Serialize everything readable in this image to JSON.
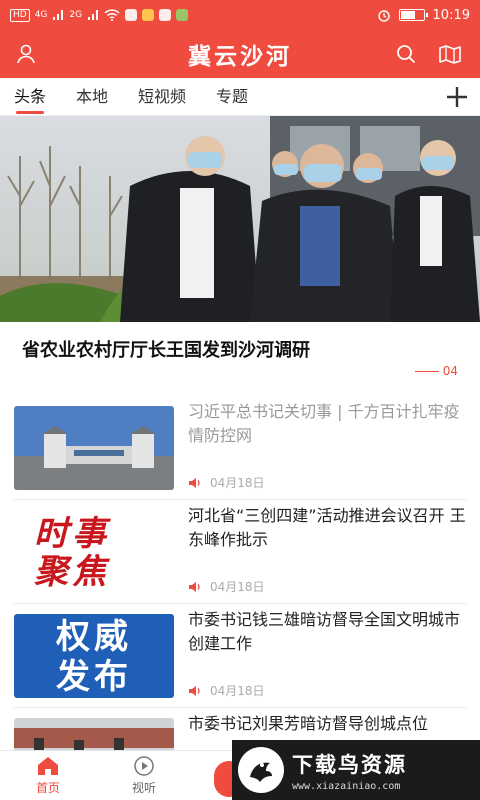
{
  "status_bar": {
    "left_chip": "HD",
    "signal_1": "4G",
    "signal_2": "2G",
    "time": "10:19"
  },
  "header": {
    "title": "冀云沙河"
  },
  "tabs": [
    {
      "label": "头条",
      "active": true
    },
    {
      "label": "本地",
      "active": false
    },
    {
      "label": "短视频",
      "active": false
    },
    {
      "label": "专题",
      "active": false
    }
  ],
  "hero": {
    "title": "省农业农村厅厅长王国发到沙河调研",
    "index": "04"
  },
  "news": [
    {
      "title": "习近平总书记关切事 | 千方百计扎牢疫情防控网",
      "date": "04月18日",
      "visited": true
    },
    {
      "title": "河北省“三创四建”活动推进会议召开 王东峰作批示",
      "date": "04月18日",
      "visited": false,
      "thumb_text": [
        "时事",
        "聚焦"
      ]
    },
    {
      "title": "市委书记钱三雄暗访督导全国文明城市创建工作",
      "date": "04月18日",
      "visited": false,
      "thumb_text": [
        "权威",
        "发布"
      ]
    },
    {
      "title": "市委书记刘果芳暗访督导创城点位",
      "date": "",
      "visited": false
    }
  ],
  "bottom_nav": [
    {
      "label": "首页",
      "icon": "home-icon",
      "active": true
    },
    {
      "label": "视听",
      "icon": "play-icon",
      "active": false
    }
  ],
  "watermark": {
    "text": "下载鸟资源",
    "url": "www.xiazainiao.com"
  },
  "colors": {
    "accent": "#ef4b3f",
    "background": "#f2f2f2"
  }
}
